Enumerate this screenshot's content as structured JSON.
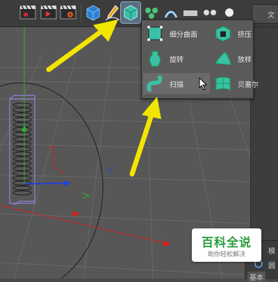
{
  "toolbar": {
    "right_tab_label": "文",
    "buttons": [
      {
        "name": "render-region-button",
        "icon": "clapper-icon"
      },
      {
        "name": "render-view-button",
        "icon": "clapper-play-icon"
      },
      {
        "name": "render-settings-button",
        "icon": "clapper-gear-icon"
      },
      {
        "name": "cube-button",
        "icon": "cube-icon"
      },
      {
        "name": "pen-button",
        "icon": "pen-icon"
      },
      {
        "name": "generators-button",
        "icon": "subdivision-cube-icon",
        "active": true
      }
    ]
  },
  "popup": {
    "items": [
      {
        "id": "subdivision",
        "label": "细分曲面",
        "icon": "subdivision-surface-icon"
      },
      {
        "id": "extrude",
        "label": "挤压",
        "icon": "extrude-icon"
      },
      {
        "id": "lathe",
        "label": "旋转",
        "icon": "lathe-icon"
      },
      {
        "id": "loft",
        "label": "放样",
        "icon": "loft-icon"
      },
      {
        "id": "sweep",
        "label": "扫描",
        "icon": "sweep-icon",
        "highlighted": true
      },
      {
        "id": "bezier",
        "label": "贝塞尔",
        "icon": "bezier-icon"
      }
    ]
  },
  "watermark": {
    "title": "百科全说",
    "subtitle": "助你轻松解决"
  },
  "bottom_panel": {
    "line1": "模",
    "line2": "圆",
    "line3": "基本"
  },
  "colors": {
    "accent_arrow": "#f2e600",
    "object_outline": "#9b8fff",
    "axis_x": "#d42020",
    "axis_y": "#2bb52b",
    "axis_z": "#2440d8",
    "watermark_green": "#2a9c3c"
  }
}
